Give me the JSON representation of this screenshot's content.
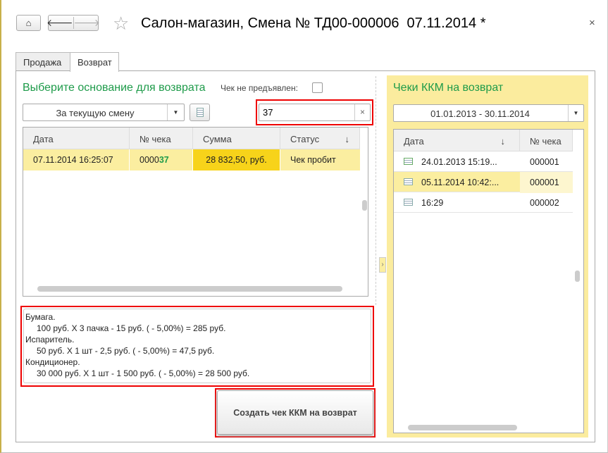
{
  "window": {
    "title": "Салон-магазин, Смена № ТД00-000006  07.11.2014 *"
  },
  "tabs": [
    {
      "label": "Продажа"
    },
    {
      "label": "Возврат"
    }
  ],
  "left": {
    "heading": "Выберите основание для возврата",
    "check_not_shown_label": "Чек не предъявлен:",
    "period_select": "За текущую смену",
    "search_value": "37",
    "columns": [
      "Дата",
      "№ чека",
      "Сумма",
      "Статус"
    ],
    "rows": [
      {
        "date": "07.11.2014 16:25:07",
        "num_prefix": "0000",
        "num_match": "37",
        "sum": "28 832,50, руб.",
        "status": "Чек пробит"
      }
    ],
    "details": [
      "Бумага.",
      "100 руб. Х 3 пачка - 15 руб. ( - 5,00%) = 285 руб.",
      "Испаритель.",
      "50 руб. Х 1 шт - 2,5 руб. ( - 5,00%) = 47,5 руб.",
      "Кондиционер.",
      "30 000 руб. Х 1 шт - 1 500 руб. ( - 5,00%) = 28 500 руб."
    ],
    "create_button": "Создать чек ККМ на возврат"
  },
  "right": {
    "heading": "Чеки ККМ на возврат",
    "period": "01.01.2013 - 30.11.2014",
    "columns": [
      "Дата",
      "№ чека"
    ],
    "rows": [
      {
        "date": "24.01.2013 15:19...",
        "num": "000001",
        "icon": "check-doc"
      },
      {
        "date": "05.11.2014 10:42:...",
        "num": "000001",
        "icon": "doc"
      },
      {
        "date": "16:29",
        "num": "000002",
        "icon": "doc"
      }
    ]
  },
  "colors": {
    "accent": "#1e9b4a",
    "highlight": "#fbeea0",
    "sum_highlight": "#f7d31a",
    "panel_yellow": "#fbec9e",
    "red_frame": "#e00000"
  }
}
